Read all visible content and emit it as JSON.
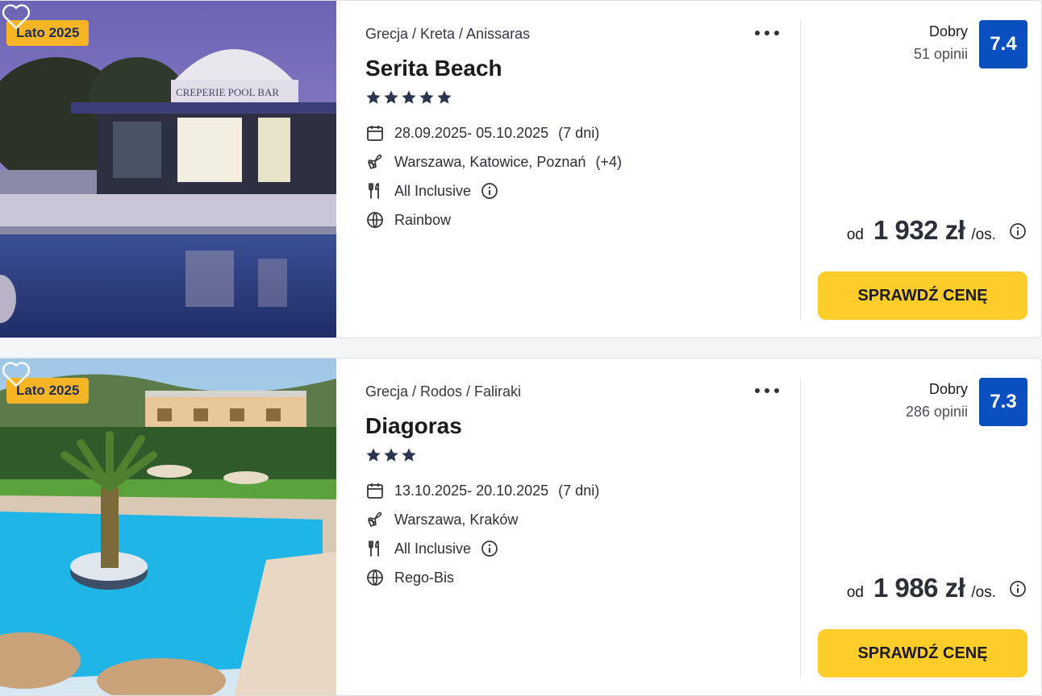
{
  "offers": [
    {
      "season_badge": "Lato 2025",
      "location": "Grecja / Kreta / Anissaras",
      "hotel_name": "Serita Beach",
      "stars": 5,
      "dates": "28.09.2025- 05.10.2025",
      "duration": "(7 dni)",
      "departures": "Warszawa, Katowice, Poznań",
      "departures_more": "(+4)",
      "board": "All Inclusive",
      "operator": "Rainbow",
      "rating_label": "Dobry",
      "reviews": "51 opinii",
      "score": "7.4",
      "price_prefix": "od",
      "price": "1 932 zł",
      "price_suffix": "/os.",
      "cta_label": "SPRAWDŹ CENĘ",
      "photo_text": "CREPERIE   POOL BAR"
    },
    {
      "season_badge": "Lato 2025",
      "location": "Grecja / Rodos / Faliraki",
      "hotel_name": "Diagoras",
      "stars": 3,
      "dates": "13.10.2025- 20.10.2025",
      "duration": "(7 dni)",
      "departures": "Warszawa, Kraków",
      "departures_more": "",
      "board": "All Inclusive",
      "operator": "Rego-Bis",
      "rating_label": "Dobry",
      "reviews": "286 opinii",
      "score": "7.3",
      "price_prefix": "od",
      "price": "1 986 zł",
      "price_suffix": "/os.",
      "cta_label": "SPRAWDŹ CENĘ"
    }
  ],
  "colors": {
    "badge_bg": "#f7b526",
    "score_bg": "#0a4fc0",
    "cta_bg": "#fecd2a",
    "star": "#2b3550"
  }
}
